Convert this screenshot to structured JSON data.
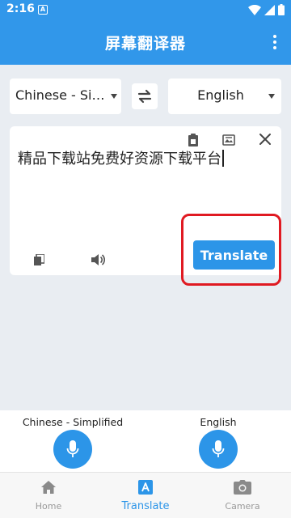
{
  "status_bar": {
    "time": "2:16",
    "notification_icon": "A"
  },
  "app_bar": {
    "title": "屏幕翻译器"
  },
  "languages": {
    "source": "Chinese - Simplified",
    "target": "English"
  },
  "input": {
    "text": "精品下载站免费好资源下载平台"
  },
  "actions": {
    "translate_label": "Translate"
  },
  "voice": {
    "source_label": "Chinese - Simplified",
    "target_label": "English"
  },
  "bottom_nav": {
    "items": [
      {
        "label": "Home",
        "icon": "home-icon"
      },
      {
        "label": "Translate",
        "icon": "translate-icon"
      },
      {
        "label": "Camera",
        "icon": "camera-icon"
      }
    ],
    "active": "Translate"
  },
  "colors": {
    "primary": "#3197ea",
    "button": "#2c95e8",
    "highlight": "#e01a22",
    "background": "#e9edf2"
  }
}
